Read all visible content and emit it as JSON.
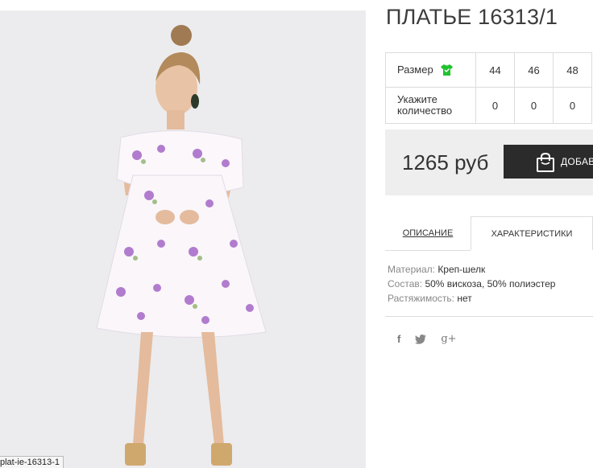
{
  "product": {
    "title": "ПЛАТЬЕ 16313/1",
    "image_caption": "plat-ie-16313-1"
  },
  "sizes": {
    "size_label": "Размер",
    "size_icon": "tshirt-icon",
    "size_icon_color": "#1fc32e",
    "values": [
      "44",
      "46",
      "48"
    ],
    "quantity_label_line1": "Укажите",
    "quantity_label_line2": "количество",
    "quantities": [
      "0",
      "0",
      "0"
    ]
  },
  "purchase": {
    "price": "1265 руб",
    "add_button_label": "ДОБАВ",
    "button_icon": "shopping-bag-icon"
  },
  "tabs": {
    "description": "ОПИСАНИЕ",
    "characteristics": "ХАРАКТЕРИСТИКИ",
    "active": "characteristics"
  },
  "characteristics": [
    {
      "key": "Материал:",
      "value": "Креп-шелк"
    },
    {
      "key": "Состав:",
      "value": "50% вискоза, 50% полиэстер"
    },
    {
      "key": "Растяжимость:",
      "value": "нет"
    }
  ],
  "social": {
    "facebook": "f",
    "twitter": "twitter-icon",
    "googleplus": "g+"
  }
}
